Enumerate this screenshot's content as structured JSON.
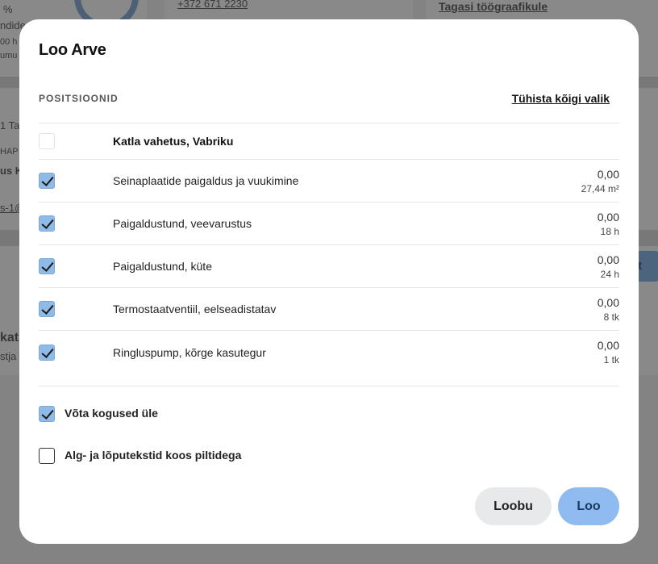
{
  "background": {
    "percent": "%",
    "phone": "+372 671 2230",
    "back_link": "Tagasi töögraafikule",
    "frag_1": "ndide",
    "frag_2": "00 h",
    "frag_3": "umu",
    "frag_4": "1 Ta",
    "frag_5": "HAP",
    "frag_6": "us K",
    "frag_7": "s-1@",
    "frag_8": "kath",
    "frag_9": "stja",
    "pill_text": "nt"
  },
  "modal": {
    "title": "Loo Arve",
    "section_label": "POSITSIOONID",
    "clear_selection": "Tühista kõigi valik",
    "group": {
      "label": "Katla vahetus, Vabriku",
      "checked": false
    },
    "items": [
      {
        "label": "Seinaplaatide paigaldus ja vuukimine",
        "amount": "0,00",
        "qty": "27,44 m²",
        "checked": true
      },
      {
        "label": "Paigaldustund, veevarustus",
        "amount": "0,00",
        "qty": "18 h",
        "checked": true
      },
      {
        "label": "Paigaldustund, küte",
        "amount": "0,00",
        "qty": "24 h",
        "checked": true
      },
      {
        "label": "Termostaatventiil, eelseadistatav",
        "amount": "0,00",
        "qty": "8 tk",
        "checked": true
      },
      {
        "label": "Ringluspump, kõrge kasutegur",
        "amount": "0,00",
        "qty": "1 tk",
        "checked": true
      }
    ],
    "options": {
      "take_quantities": {
        "label": "Võta kogused üle",
        "checked": true
      },
      "texts_with_images": {
        "label": "Alg- ja lõputekstid koos piltidega",
        "checked": false
      }
    },
    "buttons": {
      "cancel": "Loobu",
      "create": "Loo"
    }
  },
  "colors": {
    "accent": "#8fbbf0",
    "checkbox": "#8fbbe6",
    "cancel_bg": "#e8e9ea"
  }
}
